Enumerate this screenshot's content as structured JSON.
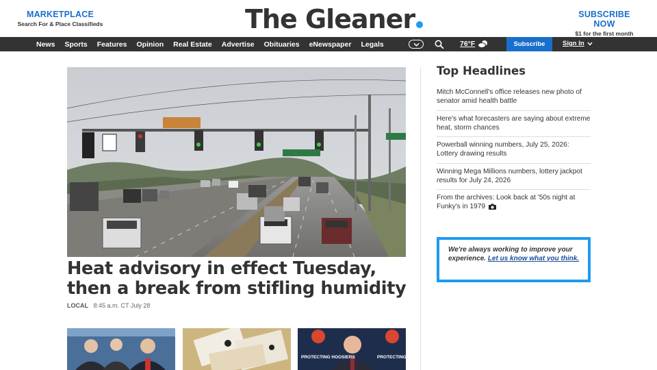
{
  "masthead": {
    "marketplace_title": "MARKETPLACE",
    "marketplace_sub": "Search For & Place Classifieds",
    "logo": "The Gleaner",
    "subscribe_title": "SUBSCRIBE NOW",
    "subscribe_sub": "$1 for the first month"
  },
  "nav": {
    "items": [
      "News",
      "Sports",
      "Features",
      "Opinion",
      "Real Estate",
      "Advertise",
      "Obituaries",
      "eNewspaper",
      "Legals"
    ],
    "weather": "76°F",
    "subscribe": "Subscribe",
    "signin": "Sign In"
  },
  "hero": {
    "headline": "Heat advisory in effect Tuesday, then a break from stifling humidity",
    "label": "LOCAL",
    "time": "8:45 a.m. CT July 28"
  },
  "top_headlines": {
    "title": "Top Headlines",
    "items": [
      "Mitch McConnell's office releases new photo of senator amid health battle",
      "Here's what forecasters are saying about extreme heat, storm chances",
      "Powerball winning numbers, July 25, 2026: Lottery drawing results",
      "Winning Mega Millions numbers, lottery jackpot results for July 24, 2026",
      "From the archives: Look back at '50s night at Funky's in 1979"
    ]
  },
  "feedback": {
    "text": "We're always working to improve your experience.",
    "link": "Let us know what you think."
  },
  "thumb3": {
    "sign_text": "PROTECTING HOOSIERS"
  },
  "colors": {
    "accent": "#1a6ecc",
    "nav_bg": "#333333",
    "logo_dot": "#1d9bf0"
  }
}
